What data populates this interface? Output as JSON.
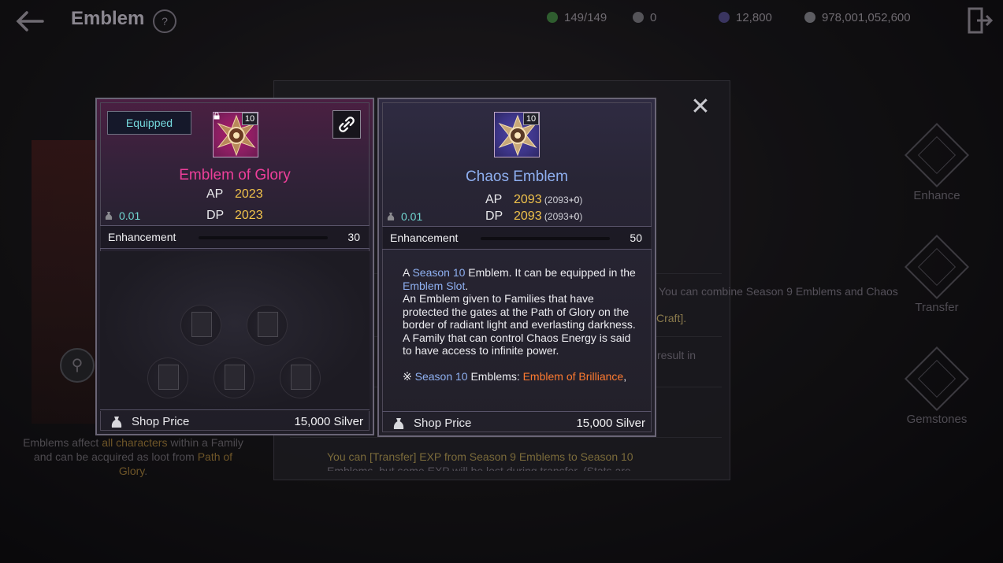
{
  "header": {
    "title": "Emblem",
    "resources": [
      {
        "name": "stamina",
        "value": "149/149",
        "color": "#2f5d2f"
      },
      {
        "name": "crystal",
        "value": "0",
        "color": "#6a6a70"
      },
      {
        "name": "gem",
        "value": "12,800",
        "color": "#3a3560"
      },
      {
        "name": "silver",
        "value": "978,001,052,600",
        "color": "#707070"
      }
    ]
  },
  "background": {
    "panel_lines": [
      "You can combine Season 9 Emblems and Chaos",
      "Craft].",
      "result in",
      "You can [Transfer] EXP from Season 9 Emblems to Season 10",
      "Emblems, but some EXP will be lost during transfer. (Stats are"
    ],
    "left_note_1": "Emblems affect ",
    "left_note_hl1": "all characters",
    "left_note_2": " within a Family and can be acquired as loot from ",
    "left_note_hl2": "Path of Glory",
    "left_note_3": "."
  },
  "actions": [
    {
      "label": "Enhance",
      "icon": "enhance-icon"
    },
    {
      "label": "Transfer",
      "icon": "transfer-icon"
    },
    {
      "label": "Gemstones",
      "icon": "gemstones-icon"
    }
  ],
  "left_card": {
    "badge": "Equipped",
    "level": "10",
    "name": "Emblem of Glory",
    "ap_label": "AP",
    "ap_value": "2023",
    "dp_label": "DP",
    "dp_value": "2023",
    "weight": "0.01",
    "enhancement_label": "Enhancement",
    "enhancement_value": "30",
    "enhancement_fraction": 0.0,
    "shop_label": "Shop Price",
    "shop_value": "15,000 Silver",
    "slots_locked": 5
  },
  "right_card": {
    "level": "10",
    "name": "Chaos Emblem",
    "ap_label": "AP",
    "ap_value": "2093",
    "ap_sub_open": " (2093",
    "ap_sub_plus": "+0",
    "ap_sub_close": ")",
    "dp_label": "DP",
    "dp_value": "2093",
    "dp_sub_open": " (2093",
    "dp_sub_plus": "+0",
    "dp_sub_close": ")",
    "weight": "0.01",
    "enhancement_label": "Enhancement",
    "enhancement_value": "50",
    "enhancement_fraction": 0.0,
    "desc_a": "A ",
    "desc_season": "Season 10",
    "desc_b": " Emblem. It can be equipped in the ",
    "desc_slot": "Emblem Slot",
    "desc_c": ".",
    "desc_body": "An Emblem given to Families that have protected the gates at the Path of Glory on the border of radiant light and everlasting darkness. A Family that can control Chaos Energy is said to have access to infinite power.",
    "desc_note_mark": "※ ",
    "desc_note_season": "Season 10",
    "desc_note_mid": " Emblems: ",
    "desc_note_item": "Emblem of Brilliance",
    "desc_note_end": ",",
    "shop_label": "Shop Price",
    "shop_value": "15,000 Silver"
  }
}
